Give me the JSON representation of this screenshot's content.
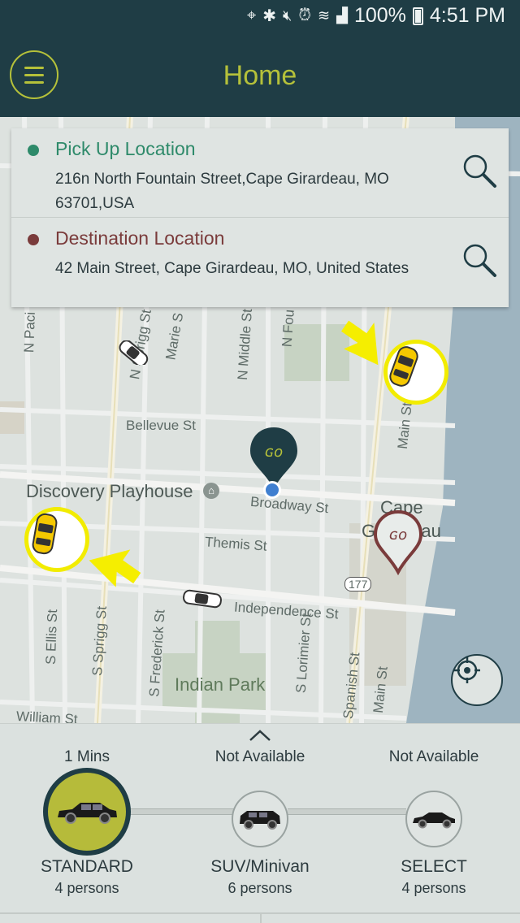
{
  "status_bar": {
    "battery": "100%",
    "time": "4:51 PM"
  },
  "header": {
    "title": "Home"
  },
  "locations": {
    "pickup": {
      "label": "Pick Up Location",
      "address": "216n North Fountain Street,Cape Girardeau, MO 63701,USA",
      "color": "#2e8a6a"
    },
    "destination": {
      "label": "Destination Location",
      "address": "42 Main Street, Cape Girardeau, MO, United States",
      "color": "#7a3b3b"
    }
  },
  "map": {
    "labels": {
      "bellevue": "Bellevue St",
      "discovery": "Discovery Playhouse",
      "broadway": "Broadway St",
      "themis": "Themis St",
      "independence": "Independence St",
      "indian_park": "Indian Park",
      "william": "William St",
      "cape": "Cape",
      "girardeau": "Girardeau",
      "main_st": "Main St",
      "main_st2": "Main St",
      "spanish_st": "Spanish St",
      "s_lorimier": "S Lorimier St",
      "s_frederick": "S Frederick St",
      "s_sprigg": "S Sprigg St",
      "s_ellis": "S Ellis St",
      "n_middle": "N Middle St",
      "n_fou": "N Fou",
      "marie": "Marie S",
      "sprigg_n": "N Sprigg St",
      "n_paci": "N Paci",
      "route": "177"
    }
  },
  "vehicles": [
    {
      "eta": "1 Mins",
      "name": "STANDARD",
      "capacity": "4 persons",
      "selected": true
    },
    {
      "eta": "Not Available",
      "name": "SUV/Minivan",
      "capacity": "6 persons",
      "selected": false
    },
    {
      "eta": "Not Available",
      "name": "SELECT",
      "capacity": "4 persons",
      "selected": false
    }
  ],
  "colors": {
    "dark": "#1f3d45",
    "accent": "#b5c13a",
    "highlight": "#f2ec00"
  }
}
